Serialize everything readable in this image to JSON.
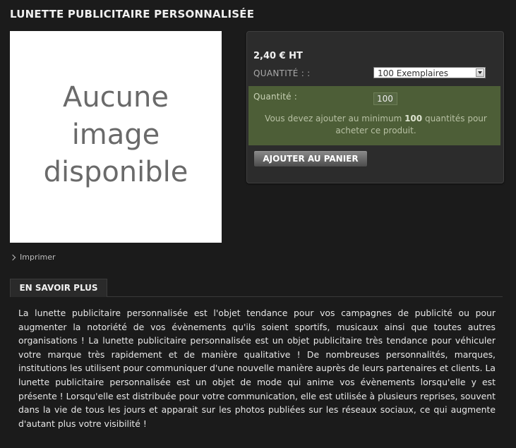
{
  "product": {
    "title": "LUNETTE PUBLICITAIRE PERSONNALISÉE",
    "image_placeholder": "Aucune\nimage\ndisponible",
    "print_label": "Imprimer"
  },
  "panel": {
    "price": "2,40 € HT",
    "quantity_option_label": "QUANTITÉ : :",
    "selected_option": "100 Exemplaires",
    "quantity_label": "Quantité :",
    "quantity_value": "100",
    "min_message_before": "Vous devez ajouter au minimum ",
    "min_message_number": "100",
    "min_message_after": " quantités pour acheter ce produit.",
    "add_to_cart": "AJOUTER AU PANIER"
  },
  "tabs": {
    "info_label": "EN SAVOIR PLUS"
  },
  "description": "La lunette publicitaire personnalisée est l'objet tendance pour vos campagnes de publicité ou pour augmenter la notoriété de vos évènements qu'ils soient sportifs, musicaux ainsi que toutes autres organisations ! La lunette publicitaire personnalisée est un objet publicitaire très tendance pour véhiculer votre marque très rapidement et de manière qualitative ! De nombreuses personnalités, marques, institutions les utilisent pour communiquer d'une nouvelle manière auprès de leurs partenaires et clients. La lunette publicitaire personnalisée est un objet de mode qui anime vos évènements lorsqu'elle y est présente ! Lorsqu'elle est distribuée pour votre communication, elle est utilisée à plusieurs reprises, souvent dans la vie de tous les jours et apparait sur les photos publiées sur les réseaux sociaux, ce qui augmente d'autant plus votre visibilité !",
  "colors": {
    "background": "#1b1b1b",
    "panel": "#2c2c2c",
    "green_box": "#4d5e37"
  }
}
